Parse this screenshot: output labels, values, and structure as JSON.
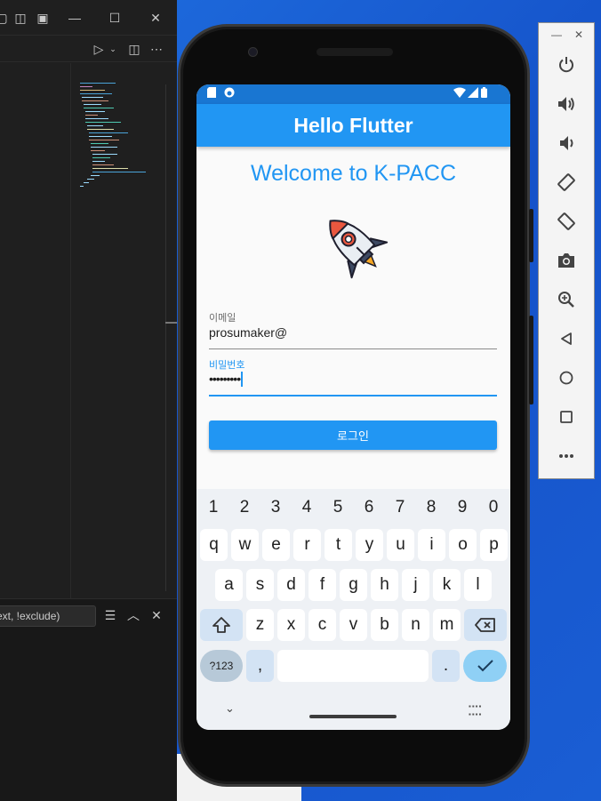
{
  "vscode": {
    "filter_placeholder": "ext, !exclude)"
  },
  "app": {
    "title": "Hello Flutter",
    "welcome": "Welcome to K-PACC",
    "email": {
      "label": "이메일",
      "value": "prosumaker@"
    },
    "password": {
      "label": "비밀번호",
      "value": "•••••••••"
    },
    "login_label": "로그인"
  },
  "keyboard": {
    "numbers": [
      "1",
      "2",
      "3",
      "4",
      "5",
      "6",
      "7",
      "8",
      "9",
      "0"
    ],
    "row1": [
      "q",
      "w",
      "e",
      "r",
      "t",
      "y",
      "u",
      "i",
      "o",
      "p"
    ],
    "row2": [
      "a",
      "s",
      "d",
      "f",
      "g",
      "h",
      "j",
      "k",
      "l"
    ],
    "row3": [
      "z",
      "x",
      "c",
      "v",
      "b",
      "n",
      "m"
    ],
    "sym_label": "?123",
    "comma": ",",
    "period": "."
  },
  "colors": {
    "primary": "#2196f3",
    "status_bar": "#1976d2",
    "desktop_blue": "#1a5fd0"
  },
  "icons": {
    "emulator": [
      "power-icon",
      "volume-up-icon",
      "volume-down-icon",
      "rotate-left-icon",
      "rotate-right-icon",
      "camera-icon",
      "zoom-icon",
      "back-icon",
      "home-icon",
      "overview-icon",
      "more-icon"
    ]
  }
}
